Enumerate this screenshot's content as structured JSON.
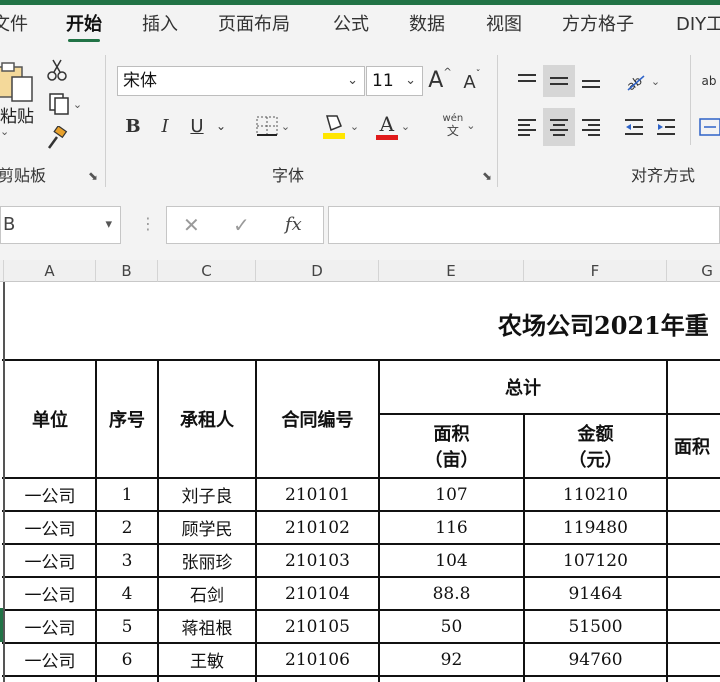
{
  "tabs": [
    {
      "label": "文件"
    },
    {
      "label": "开始"
    },
    {
      "label": "插入"
    },
    {
      "label": "页面布局"
    },
    {
      "label": "公式"
    },
    {
      "label": "数据"
    },
    {
      "label": "视图"
    },
    {
      "label": "方方格子"
    },
    {
      "label": "DIY工"
    }
  ],
  "ribbon": {
    "clipboard_label": "剪贴板",
    "paste_label": "粘贴",
    "font_name": "宋体",
    "font_size": "11",
    "bold": "B",
    "italic": "I",
    "underline": "U",
    "font_color_letter": "A",
    "phonetic_top": "wén",
    "phonetic_bottom": "文",
    "grow_font": "A",
    "shrink_font": "A",
    "font_group_label": "字体",
    "align_group_label": "对齐方式",
    "wrap_label": "ab",
    "font_color": "#e01a1a",
    "fill_color": "#ffe600"
  },
  "formula_bar": {
    "name_box_value": "B",
    "cancel_symbol": "✕",
    "enter_symbol": "✓",
    "fx_symbol": "fx",
    "formula_value": ""
  },
  "sheet": {
    "columns": [
      "A",
      "B",
      "C",
      "D",
      "E",
      "F",
      "G"
    ],
    "title": "农场公司2021年重",
    "headers": {
      "unit": "单位",
      "seq": "序号",
      "tenant": "承租人",
      "contract": "合同编号",
      "total": "总计",
      "area_line1": "面积",
      "area_line2": "（亩）",
      "amount_line1": "金额",
      "amount_line2": "（元）",
      "area_partial": "面积"
    },
    "rows": [
      {
        "unit": "一公司",
        "seq": "1",
        "tenant": "刘子良",
        "contract": "210101",
        "area": "107",
        "amount": "110210"
      },
      {
        "unit": "一公司",
        "seq": "2",
        "tenant": "顾学民",
        "contract": "210102",
        "area": "116",
        "amount": "119480"
      },
      {
        "unit": "一公司",
        "seq": "3",
        "tenant": "张丽珍",
        "contract": "210103",
        "area": "104",
        "amount": "107120"
      },
      {
        "unit": "一公司",
        "seq": "4",
        "tenant": "石剑",
        "contract": "210104",
        "area": "88.8",
        "amount": "91464"
      },
      {
        "unit": "一公司",
        "seq": "5",
        "tenant": "蒋祖根",
        "contract": "210105",
        "area": "50",
        "amount": "51500"
      },
      {
        "unit": "一公司",
        "seq": "6",
        "tenant": "王敏",
        "contract": "210106",
        "area": "92",
        "amount": "94760"
      }
    ]
  }
}
